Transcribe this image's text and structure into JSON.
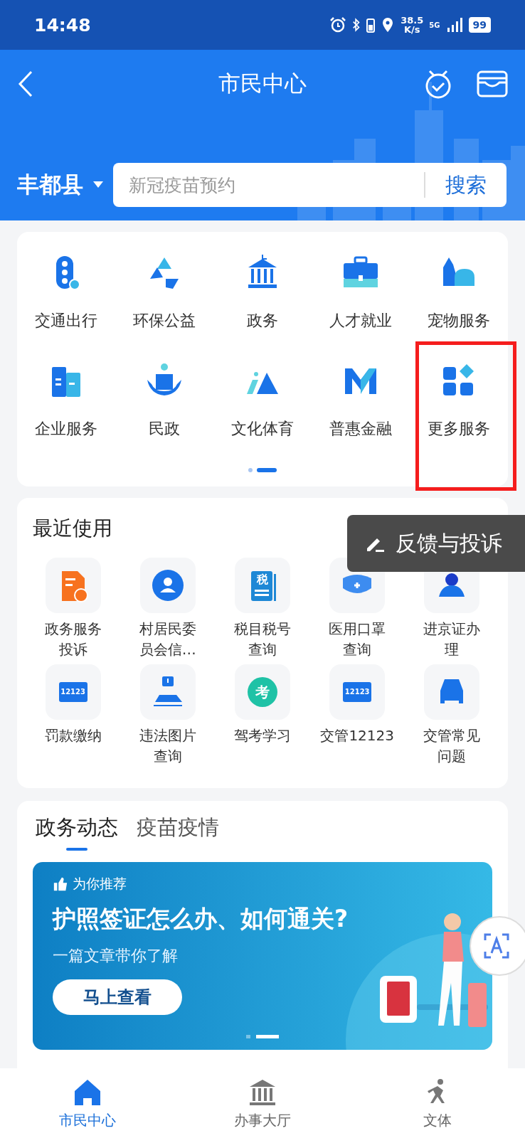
{
  "status_bar": {
    "time": "14:48",
    "speed": "38.5",
    "speed_unit": "K/s",
    "network": "5G",
    "battery": "99"
  },
  "header": {
    "title": "市民中心"
  },
  "location": {
    "label": "丰都县"
  },
  "search": {
    "placeholder": "新冠疫苗预约",
    "button": "搜索"
  },
  "services": {
    "items": [
      {
        "label": "交通出行",
        "highlighted": false
      },
      {
        "label": "环保公益",
        "highlighted": false
      },
      {
        "label": "政务",
        "highlighted": false
      },
      {
        "label": "人才就业",
        "highlighted": false
      },
      {
        "label": "宠物服务",
        "highlighted": false
      },
      {
        "label": "企业服务",
        "highlighted": false
      },
      {
        "label": "民政",
        "highlighted": false
      },
      {
        "label": "文化体育",
        "highlighted": false
      },
      {
        "label": "普惠金融",
        "highlighted": false
      },
      {
        "label": "更多服务",
        "highlighted": true
      }
    ],
    "pages": [
      {
        "selected": false
      },
      {
        "selected": true
      }
    ]
  },
  "recent": {
    "title": "最近使用",
    "items": [
      {
        "lines": [
          "政务服务",
          "投诉"
        ]
      },
      {
        "lines": [
          "村居民委",
          "员会信…"
        ]
      },
      {
        "lines": [
          "税目税号",
          "查询"
        ],
        "icon_text": "税"
      },
      {
        "lines": [
          "医用口罩",
          "查询"
        ]
      },
      {
        "lines": [
          "进京证办",
          "理"
        ]
      },
      {
        "lines": [
          "罚款缴纳"
        ],
        "icon_text": "12123"
      },
      {
        "lines": [
          "违法图片",
          "查询"
        ]
      },
      {
        "lines": [
          "驾考学习"
        ],
        "icon_text": "考"
      },
      {
        "lines": [
          "交管12123"
        ],
        "icon_text": "12123"
      },
      {
        "lines": [
          "交管常见",
          "问题"
        ]
      }
    ]
  },
  "feedback": {
    "label": "反馈与投诉"
  },
  "news": {
    "tabs": [
      {
        "label": "政务动态",
        "selected": true
      },
      {
        "label": "疫苗疫情",
        "selected": false
      }
    ],
    "banner": {
      "tag": "为你推荐",
      "title": "护照签证怎么办、如何通关?",
      "subtitle": "一篇文章带你了解",
      "button": "马上查看",
      "pages": [
        {
          "selected": false
        },
        {
          "selected": true
        }
      ]
    }
  },
  "bottom_nav": [
    {
      "label": "市民中心",
      "selected": true
    },
    {
      "label": "办事大厅",
      "selected": false
    },
    {
      "label": "文体",
      "selected": false
    }
  ]
}
